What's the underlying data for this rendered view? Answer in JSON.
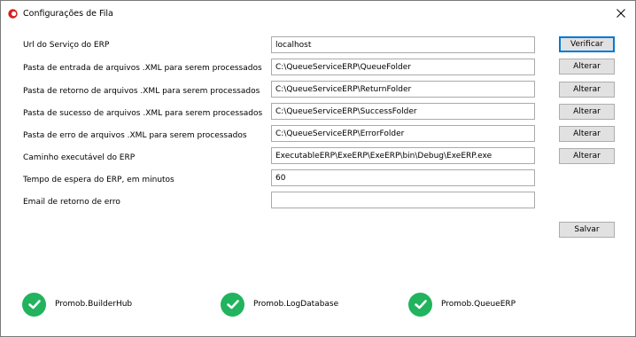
{
  "window": {
    "title": "Configurações de Fila",
    "icon": "app-red-circle-icon",
    "close_icon": "close-icon"
  },
  "form": {
    "rows": [
      {
        "label": "Url do Serviço do ERP",
        "value": "localhost",
        "button": "Verificar"
      },
      {
        "label": "Pasta de entrada de arquivos .XML para serem processados",
        "value": "C:\\QueueServiceERP\\QueueFolder",
        "button": "Alterar"
      },
      {
        "label": "Pasta de retorno de arquivos .XML para serem processados",
        "value": "C:\\QueueServiceERP\\ReturnFolder",
        "button": "Alterar"
      },
      {
        "label": "Pasta de sucesso de arquivos .XML para serem processados",
        "value": "C:\\QueueServiceERP\\SuccessFolder",
        "button": "Alterar"
      },
      {
        "label": "Pasta de erro de arquivos .XML para serem processados",
        "value": "C:\\QueueServiceERP\\ErrorFolder",
        "button": "Alterar"
      },
      {
        "label": "Caminho executável do ERP",
        "value": "ExecutableERP\\ExeERP\\ExeERP\\bin\\Debug\\ExeERP.exe",
        "button": "Alterar"
      },
      {
        "label": "Tempo de espera do ERP, em minutos",
        "value": "60"
      },
      {
        "label": "Email de retorno de erro",
        "value": ""
      }
    ],
    "save_label": "Salvar"
  },
  "services": [
    {
      "name": "Promob.BuilderHub",
      "status_icon": "check-circle-icon",
      "color": "#21b35d"
    },
    {
      "name": "Promob.LogDatabase",
      "status_icon": "check-circle-icon",
      "color": "#21b35d"
    },
    {
      "name": "Promob.QueueERP",
      "status_icon": "check-circle-icon",
      "color": "#21b35d"
    }
  ],
  "colors": {
    "button_bg": "#e1e1e1",
    "button_focus_border": "#0078d7",
    "app_icon": "#d62020"
  }
}
